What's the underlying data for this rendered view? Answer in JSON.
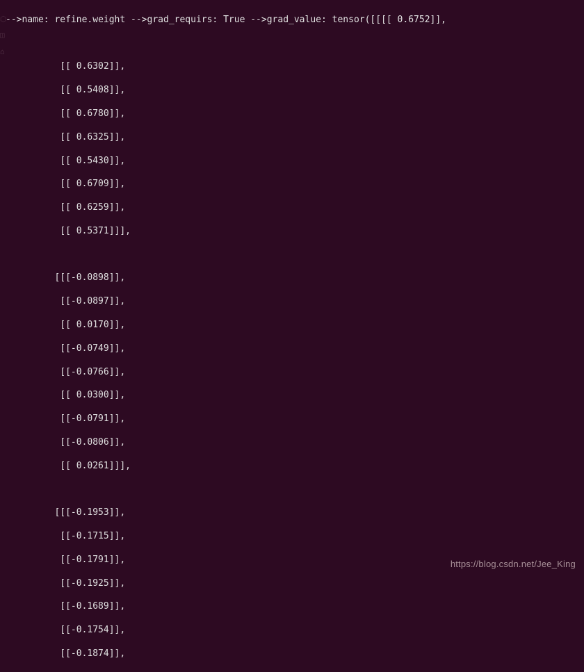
{
  "header": {
    "name_label": "-->name:",
    "name_value": "refine.weight",
    "grad_requires_label": "-->grad_requirs:",
    "grad_requires_value": "True",
    "grad_value_label": "-->grad_value:",
    "grad_value_prefix": "tensor([[[[ 0.6752]],"
  },
  "block1": [
    "          [[ 0.6302]],",
    "",
    "          [[ 0.5408]],",
    "",
    "          [[ 0.6780]],",
    "",
    "          [[ 0.6325]],",
    "",
    "          [[ 0.5430]],",
    "",
    "          [[ 0.6709]],",
    "",
    "          [[ 0.6259]],",
    "",
    "          [[ 0.5371]]],",
    "",
    ""
  ],
  "block2": [
    "         [[[-0.0898]],",
    "",
    "          [[-0.0897]],",
    "",
    "          [[ 0.0170]],",
    "",
    "          [[-0.0749]],",
    "",
    "          [[-0.0766]],",
    "",
    "          [[ 0.0300]],",
    "",
    "          [[-0.0791]],",
    "",
    "          [[-0.0806]],",
    "",
    "          [[ 0.0261]]],",
    "",
    ""
  ],
  "block3": [
    "         [[[-0.1953]],",
    "",
    "          [[-0.1715]],",
    "",
    "          [[-0.1791]],",
    "",
    "          [[-0.1925]],",
    "",
    "          [[-0.1689]],",
    "",
    "          [[-0.1754]],",
    "",
    "          [[-0.1874]],"
  ],
  "watermark": "https://blog.csdn.net/Jee_King"
}
